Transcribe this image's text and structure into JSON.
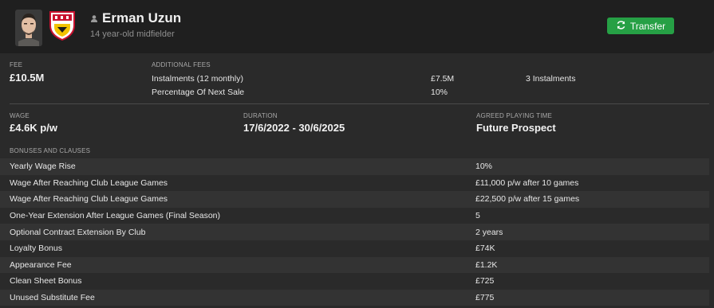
{
  "player": {
    "name": "Erman Uzun",
    "subtitle": "14 year-old midfielder"
  },
  "actions": {
    "transfer_label": "Transfer",
    "accent": "#26a045"
  },
  "fee": {
    "label": "FEE",
    "value": "£10.5M"
  },
  "additional_fees": {
    "label": "ADDITIONAL FEES",
    "rows": [
      {
        "name": "Instalments (12 monthly)",
        "amount": "£7.5M",
        "note": "3 Instalments"
      },
      {
        "name": "Percentage Of Next Sale",
        "amount": "10%",
        "note": ""
      }
    ]
  },
  "wage": {
    "label": "WAGE",
    "value": "£4.6K p/w"
  },
  "duration": {
    "label": "DURATION",
    "value": "17/6/2022 - 30/6/2025"
  },
  "playing_time": {
    "label": "AGREED PLAYING TIME",
    "value": "Future Prospect"
  },
  "bonuses": {
    "label": "BONUSES AND CLAUSES",
    "rows": [
      {
        "name": "Yearly Wage Rise",
        "value": "10%"
      },
      {
        "name": "Wage After Reaching Club League Games",
        "value": "£11,000 p/w after 10 games"
      },
      {
        "name": "Wage After Reaching Club League Games",
        "value": "£22,500 p/w after 15 games"
      },
      {
        "name": "One-Year Extension After League Games (Final Season)",
        "value": "5"
      },
      {
        "name": "Optional Contract Extension By Club",
        "value": "2 years"
      },
      {
        "name": "Loyalty Bonus",
        "value": "£74K"
      },
      {
        "name": "Appearance Fee",
        "value": "£1.2K"
      },
      {
        "name": "Clean Sheet Bonus",
        "value": "£725"
      },
      {
        "name": "Unused Substitute Fee",
        "value": "£775"
      }
    ]
  }
}
